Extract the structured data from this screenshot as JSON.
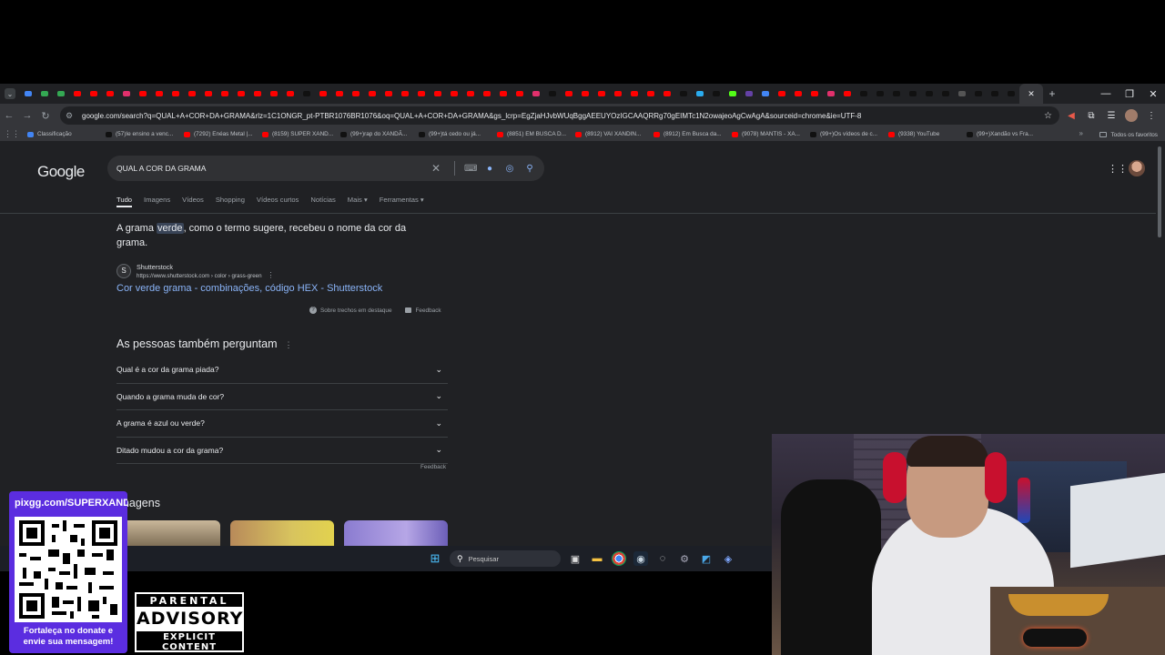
{
  "browser": {
    "url": "google.com/search?q=QUAL+A+COR+DA+GRAMA&rlz=1C1ONGR_pt-PTBR1076BR1076&oq=QUAL+A+COR+DA+GRAMA&gs_lcrp=EgZjaHJvbWUqBggAEEUYOzIGCAAQRRg70gEIMTc1N2owajeoAgCwAgA&sourceid=chrome&ie=UTF-8",
    "bookmarks": [
      {
        "label": "Classificação",
        "color": "#4285f4"
      },
      {
        "label": "(57)Ie ensino a venc...",
        "color": "#111111"
      },
      {
        "label": "(7292) Enéas Metal |...",
        "color": "#ff0000"
      },
      {
        "label": "(8159) SUPER XAND...",
        "color": "#ff0000"
      },
      {
        "label": "(99+)rap do XANDÃ...",
        "color": "#111111"
      },
      {
        "label": "(99+)tá cedo ou já...",
        "color": "#111111"
      },
      {
        "label": "(8851) EM BUSCA D...",
        "color": "#ff0000"
      },
      {
        "label": "(8912) VAI XANDIN...",
        "color": "#ff0000"
      },
      {
        "label": "(8912) Em Busca da...",
        "color": "#ff0000"
      },
      {
        "label": "(9078) MANTIS - XA...",
        "color": "#ff0000"
      },
      {
        "label": "(99+)Os vídeos de c...",
        "color": "#111111"
      },
      {
        "label": "(9338) YouTube",
        "color": "#ff0000"
      },
      {
        "label": "(99+)Xandão vs Fra...",
        "color": "#111111"
      }
    ],
    "all_bookmarks": "Todos os favoritos"
  },
  "search": {
    "logo": "Google",
    "query": "QUAL A COR DA GRAMA",
    "tabs": [
      "Tudo",
      "Imagens",
      "Vídeos",
      "Shopping",
      "Vídeos curtos",
      "Notícias",
      "Mais ▾",
      "Ferramentas ▾"
    ]
  },
  "featured": {
    "text_before": "A grama ",
    "highlight": "verde",
    "text_after": ", como o termo sugere, recebeu o nome da cor da grama.",
    "source_name": "Shutterstock",
    "source_cite": "https://www.shutterstock.com › color › grass-green",
    "link_title": "Cor verde grama - combinações, código HEX - Shutterstock",
    "about": "Sobre trechos em destaque",
    "feedback": "Feedback"
  },
  "paa": {
    "title": "As pessoas também perguntam",
    "questions": [
      "Qual é a cor da grama piada?",
      "Quando a grama muda de cor?",
      "A grama é azul ou verde?",
      "Ditado mudou a cor da grama?"
    ],
    "feedback": "Feedback"
  },
  "images_section": {
    "title": "Imagens"
  },
  "taskbar": {
    "search_placeholder": "Pesquisar"
  },
  "overlay": {
    "qr_url": "pixgg.com/SUPERXANDÃO",
    "qr_caption_1": "Fortaleça no donate e",
    "qr_caption_2": "envie sua mensagem!",
    "advisory_1": "PARENTAL",
    "advisory_2": "ADVISORY",
    "advisory_3": "EXPLICIT CONTENT"
  }
}
